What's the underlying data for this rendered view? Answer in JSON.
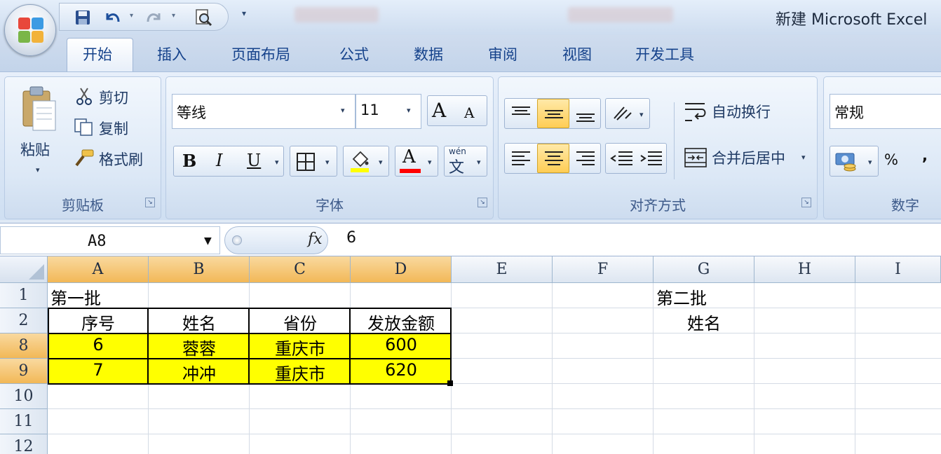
{
  "window": {
    "title": "新建 Microsoft Excel"
  },
  "quick_access": {
    "icons": [
      "save-icon",
      "undo-icon",
      "redo-icon",
      "print-preview-icon",
      "customize-icon"
    ]
  },
  "tabs": [
    {
      "label": "开始",
      "active": true
    },
    {
      "label": "插入"
    },
    {
      "label": "页面布局"
    },
    {
      "label": "公式"
    },
    {
      "label": "数据"
    },
    {
      "label": "审阅"
    },
    {
      "label": "视图"
    },
    {
      "label": "开发工具"
    }
  ],
  "ribbon": {
    "clipboard": {
      "label": "剪贴板",
      "paste": "粘贴",
      "cut": "剪切",
      "copy": "复制",
      "format_painter": "格式刷"
    },
    "font": {
      "label": "字体",
      "font_name": "等线",
      "font_size": "11",
      "bold": "B",
      "italic": "I",
      "underline": "U",
      "font_color_glyph": "A",
      "grow_glyph": "A",
      "shrink_glyph": "A",
      "phonetic_top": "wén",
      "phonetic_bottom": "文",
      "fill_color": "#ffff00",
      "font_color": "#ff0000"
    },
    "alignment": {
      "label": "对齐方式",
      "wrap_text": "自动换行",
      "merge_center": "合并后居中"
    },
    "number": {
      "label": "数字",
      "format": "常规",
      "percent": "%",
      "comma": ","
    }
  },
  "formula_bar": {
    "name_box": "A8",
    "fx": "fx",
    "value": "6"
  },
  "sheet": {
    "columns": [
      "A",
      "B",
      "C",
      "D",
      "E",
      "F",
      "G",
      "H",
      "I"
    ],
    "selected_columns": [
      "A",
      "B",
      "C",
      "D"
    ],
    "rows": [
      "1",
      "2",
      "8",
      "9",
      "10",
      "11",
      "12"
    ],
    "selected_rows": [
      "8",
      "9"
    ],
    "cells": {
      "A1": "第一批",
      "G1": "第二批",
      "A2": "序号",
      "B2": "姓名",
      "C2": "省份",
      "D2": "发放金额",
      "G2": "姓名",
      "A8": "6",
      "B8": "蓉蓉",
      "C8": "重庆市",
      "D8": "600",
      "A9": "7",
      "B9": "冲冲",
      "C9": "重庆市",
      "D9": "620"
    },
    "highlight_color": "#ffff00"
  }
}
